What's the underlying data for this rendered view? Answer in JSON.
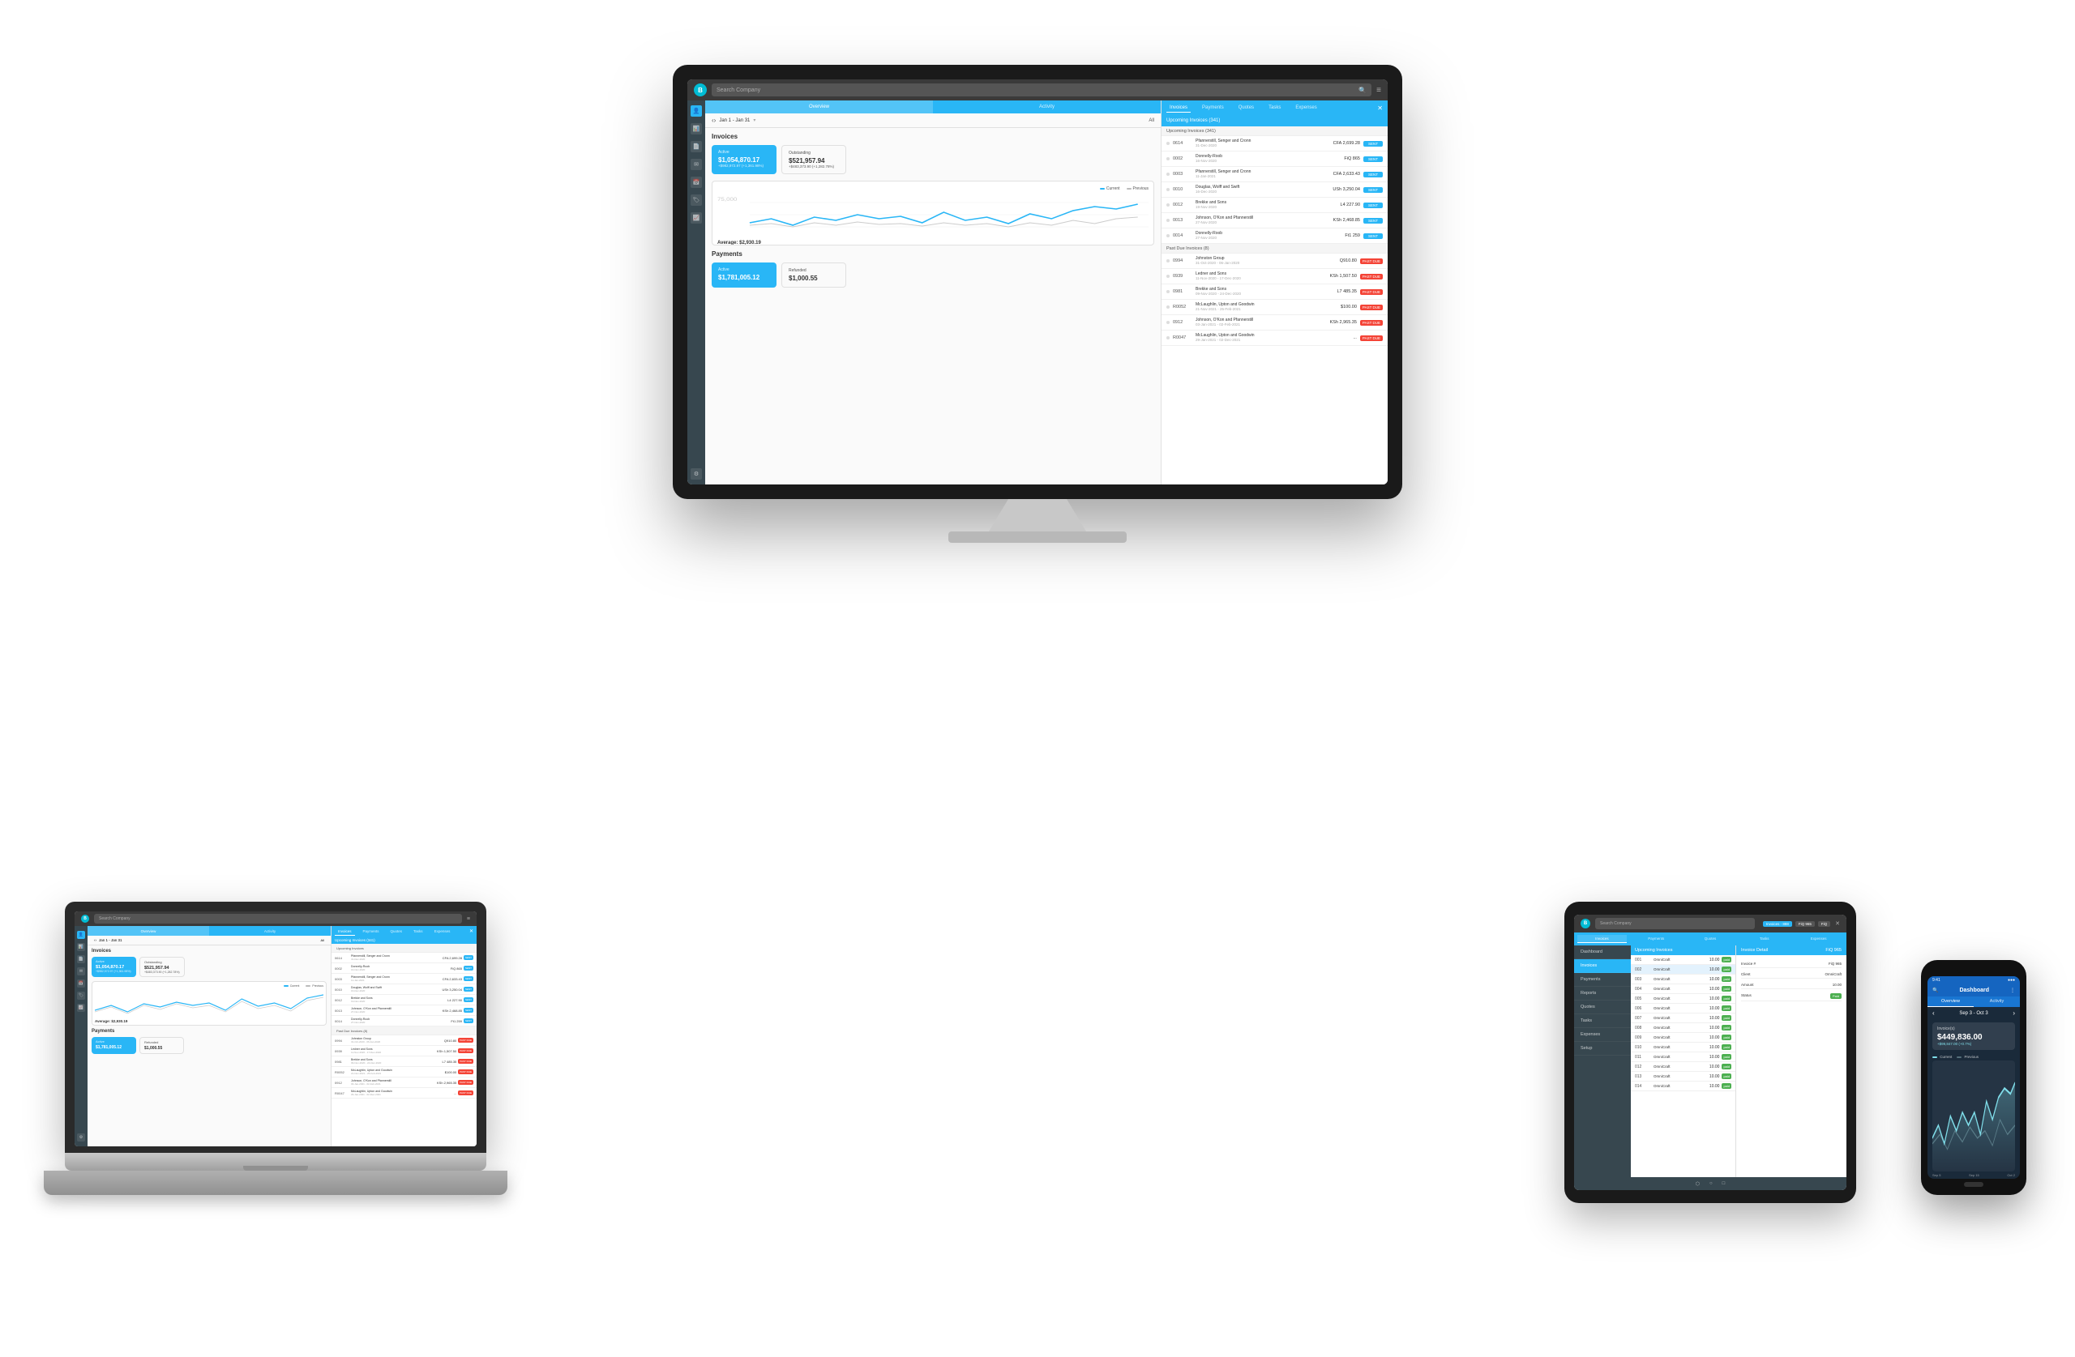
{
  "scene": {
    "background": "#ffffff"
  },
  "app": {
    "logo": "B",
    "search_placeholder": "Search Company",
    "tabs": [
      "Invoices",
      "Payments",
      "Quotes",
      "Tasks",
      "Expenses"
    ],
    "active_tab": "Invoices",
    "subtabs": [
      "Overview",
      "Activity"
    ],
    "active_subtab": "Overview",
    "date_range": "Jan 1 - Jan 31",
    "date_filter": "All"
  },
  "sidebar": {
    "icons": [
      "person",
      "chart",
      "document",
      "mail",
      "calendar",
      "tag",
      "graph",
      "settings"
    ]
  },
  "stats": {
    "active_label": "Active",
    "active_value": "$1,054,870.17",
    "active_change": "+$982,972.97 (+1,361.98%)",
    "outstanding_label": "Outstanding",
    "outstanding_value": "$521,957.94",
    "outstanding_change": "+$483,373.90 (+1,282.78%)"
  },
  "chart": {
    "avg_label": "Average: $2,930.19",
    "legend_current": "Current",
    "legend_previous": "Previous"
  },
  "upcoming_invoices": {
    "label": "Upcoming Invoices (341)",
    "items": [
      {
        "num": "0614",
        "name": "Pfannerstill, Senger and Cronn",
        "date": "31-Dec-2020",
        "ref": "CFA 2,699.28",
        "status": "SENT"
      },
      {
        "num": "0002",
        "name": "Donnelly-Roob",
        "date": "16-Nov-2020",
        "ref": "FiQ 865",
        "status": "SENT"
      },
      {
        "num": "0003",
        "name": "Pfannerstill, Senger and Cronn",
        "date": "11-Jan-2021",
        "ref": "CFA 2,633.43",
        "status": "SENT"
      },
      {
        "num": "0010",
        "name": "Douglas, Wolff and Swift",
        "date": "16-Dec-2020",
        "ref": "USh 3,250.04",
        "status": "SENT"
      },
      {
        "num": "0012",
        "name": "Brekke and Sons",
        "date": "19-Nov-2020",
        "ref": "L4 227.90",
        "status": "SENT"
      },
      {
        "num": "0013",
        "name": "Johnson, O'Kon and Pfannerstill",
        "date": "27-Nov-2020",
        "ref": "KSh 2,468.85",
        "status": "SENT"
      },
      {
        "num": "0014",
        "name": "Donnelly-Roob",
        "date": "27-Nov-2020",
        "ref": "Ft1 259",
        "status": "SENT"
      }
    ]
  },
  "past_due_invoices": {
    "label": "Past Due Invoices (8)",
    "items": [
      {
        "num": "0994",
        "name": "Johnston Group",
        "date": "31-Oct-2020 - 06-Jan-2020",
        "ref": "Q910.80",
        "status": "PAST DUE"
      },
      {
        "num": "0939",
        "name": "Ledner and Sons",
        "date": "11-Nov-2020 - 17-Dec-2020",
        "ref": "KSh 1,507.50",
        "status": "PAST DUE"
      },
      {
        "num": "0981",
        "name": "Brekke and Sons",
        "date": "09-Nov-2020 - 24-Dec-2020",
        "ref": "L7 485.35",
        "status": "PAST DUE"
      },
      {
        "num": "R0052",
        "name": "McLaughlin, Upton and Goodwin",
        "date": "21-Nov-2021 - 25-Feb-2021",
        "ref": "$100.00",
        "status": "PAST DUE"
      },
      {
        "num": "0912",
        "name": "Johnson, O'Kon and Pfannerstill",
        "date": "03-Jan-2021 - 02-Feb-2021",
        "ref": "KSh 2,965.35",
        "status": "PAST DUE"
      },
      {
        "num": "R0047",
        "name": "McLaughlin, Upton and Goodwin",
        "date": "29-Jan-2021 - 02-Dec-2021",
        "ref": "...",
        "status": "PAST DUE"
      }
    ]
  },
  "payments": {
    "section_label": "Payments",
    "active_label": "Active",
    "refunded_label": "Refunded"
  },
  "phone": {
    "status_left": "9:41",
    "status_right": "●●●",
    "title": "Dashboard",
    "subtabs": [
      "Overview",
      "Activity"
    ],
    "date_range": "Sep 3 - Oct 3",
    "stat_label": "Invoice(s)",
    "stat_value": "$449,836.00",
    "stat_change": "+$99,847.00 (+0.7%)",
    "legend_current": "Current",
    "legend_previous": "Previous",
    "x_labels": [
      "Sep 5",
      "Sep 15",
      "Oct 2"
    ]
  },
  "tablet": {
    "search_placeholder": "Search...",
    "invoice_tabs": [
      "Invoices - 888",
      "FiQ 965",
      "FiQ"
    ],
    "sidebar_items": [
      "Dashboard",
      "Invoices",
      "Payments",
      "Reports",
      "Quotes",
      "Tasks",
      "Expenses",
      "Setup"
    ],
    "active_sidebar": "Invoices",
    "list_header": "Upcoming Invoices",
    "detail_header_left": "Invoice Detail",
    "detail_header_right": "FiQ 965",
    "invoice_rows": [
      {
        "num": "001",
        "name": "OmniCraft",
        "amount": "10.00",
        "status": "paid"
      },
      {
        "num": "002",
        "name": "OmniCraft",
        "amount": "10.00",
        "status": "paid"
      },
      {
        "num": "003",
        "name": "OmniCraft",
        "amount": "10.00",
        "status": "paid"
      },
      {
        "num": "004",
        "name": "OmniCraft",
        "amount": "10.00",
        "status": "paid"
      },
      {
        "num": "005",
        "name": "OmniCraft",
        "amount": "10.00",
        "status": "paid"
      },
      {
        "num": "006",
        "name": "OmniCraft",
        "amount": "10.00",
        "status": "paid"
      },
      {
        "num": "007",
        "name": "OmniCraft",
        "amount": "10.00",
        "status": "paid"
      },
      {
        "num": "008",
        "name": "OmniCraft",
        "amount": "10.00",
        "status": "paid"
      },
      {
        "num": "009",
        "name": "OmniCraft",
        "amount": "10.00",
        "status": "paid"
      },
      {
        "num": "010",
        "name": "OmniCraft",
        "amount": "10.00",
        "status": "paid"
      },
      {
        "num": "011",
        "name": "OmniCraft",
        "amount": "10.00",
        "status": "paid"
      },
      {
        "num": "012",
        "name": "OmniCraft",
        "amount": "10.00",
        "status": "paid"
      },
      {
        "num": "013",
        "name": "OmniCraft",
        "amount": "10.00",
        "status": "paid"
      },
      {
        "num": "014",
        "name": "OmniCraft",
        "amount": "10.00",
        "status": "paid"
      }
    ]
  }
}
